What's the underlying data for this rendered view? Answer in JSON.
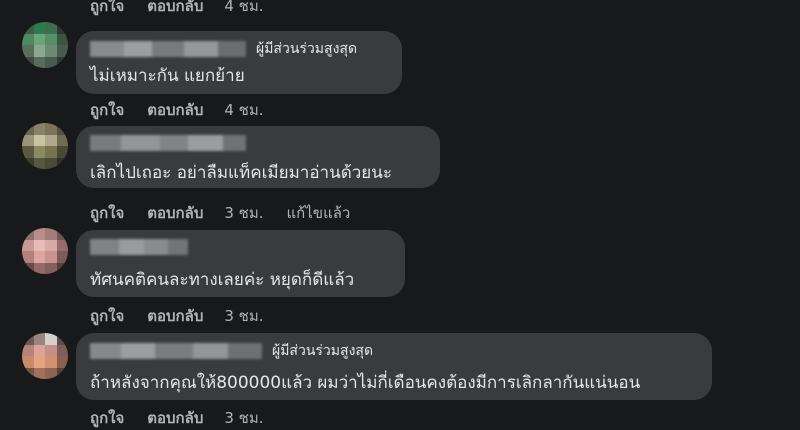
{
  "top_actions": {
    "like": "ถูกใจ",
    "reply": "ตอบกลับ",
    "time": "4 ชม."
  },
  "comments": [
    {
      "badge": "ผู้มีส่วนร่วมสูงสุด",
      "text": "ไม่เหมาะกัน แยกย้าย",
      "like": "ถูกใจ",
      "reply": "ตอบกลับ",
      "time": "4 ชม."
    },
    {
      "text": "เลิกไปเถอะ อย่าลืมแท็คเมียมาอ่านด้วยนะ",
      "like": "ถูกใจ",
      "reply": "ตอบกลับ",
      "time": "3 ชม.",
      "edited": "แก้ไขแล้ว"
    },
    {
      "text": "ทัศนคติคนละทางเลยค่ะ หยุดก็ดีแล้ว",
      "like": "ถูกใจ",
      "reply": "ตอบกลับ",
      "time": "3 ชม."
    },
    {
      "badge": "ผู้มีส่วนร่วมสูงสุด",
      "text": "ถ้าหลังจากคุณให้800000แล้ว ผมว่าไม่กี่เดือนคงต้องมีการเลิกลากันแน่นอน",
      "like": "ถูกใจ",
      "reply": "ตอบกลับ",
      "time": "3 ชม."
    }
  ]
}
